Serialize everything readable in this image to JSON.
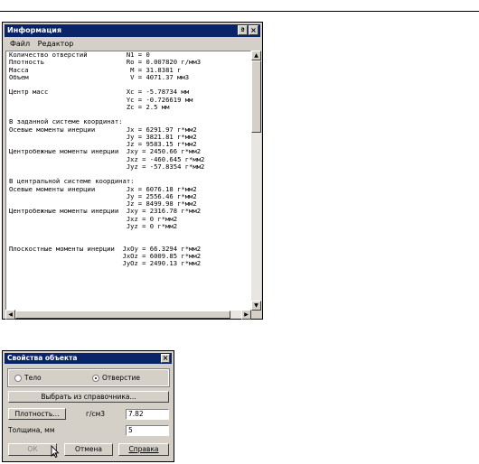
{
  "info_window": {
    "title": "Информация",
    "menu": [
      "Файл",
      "Редактор"
    ],
    "lines": [
      "Количество отверстий          N1 = 0",
      "Плотность                     Ro = 0.007820 г/мм3",
      "Масса                          M = 31.8381 г",
      "Объем                          V = 4071.37 мм3",
      "",
      "Центр масс                    Xc = -5.78734 мм",
      "                              Yc = -0.726619 мм",
      "                              Zc = 2.5 мм",
      "",
      "В заданной системе координат:",
      "Осевые моменты инерции        Jx = 6291.97 г*мм2",
      "                              Jy = 3821.81 г*мм2",
      "                              Jz = 9583.15 г*мм2",
      "Центробежные моменты инерции  Jxy = 2450.66 г*мм2",
      "                              Jxz = -460.645 г*мм2",
      "                              Jyz = -57.8354 г*мм2",
      "",
      "В центральной системе координат:",
      "Осевые моменты инерции        Jx = 6076.18 г*мм2",
      "                              Jy = 2556.46 г*мм2",
      "                              Jz = 8499.98 г*мм2",
      "Центробежные моменты инерции  Jxy = 2316.78 г*мм2",
      "                              Jxz = 0 г*мм2",
      "                              Jyz = 0 г*мм2",
      "",
      "",
      "Плоскостные моменты инерции  JxOy = 66.3294 г*мм2",
      "                             JxOz = 6009.85 г*мм2",
      "                             JyOz = 2490.13 г*мм2"
    ]
  },
  "props_dialog": {
    "title": "Свойства объекта",
    "radio_body": "Тело",
    "radio_hole": "Отверстие",
    "selected": "Отверстие",
    "select_button": "Выбрать из справочника...",
    "density_button": "Плотность...",
    "density_unit": "г/см3",
    "density_value": "7.82",
    "thickness_label": "Толщина, мм",
    "thickness_value": "5",
    "ok_label": "ОК",
    "cancel_label": "Отмена",
    "help_label": "Справка"
  }
}
